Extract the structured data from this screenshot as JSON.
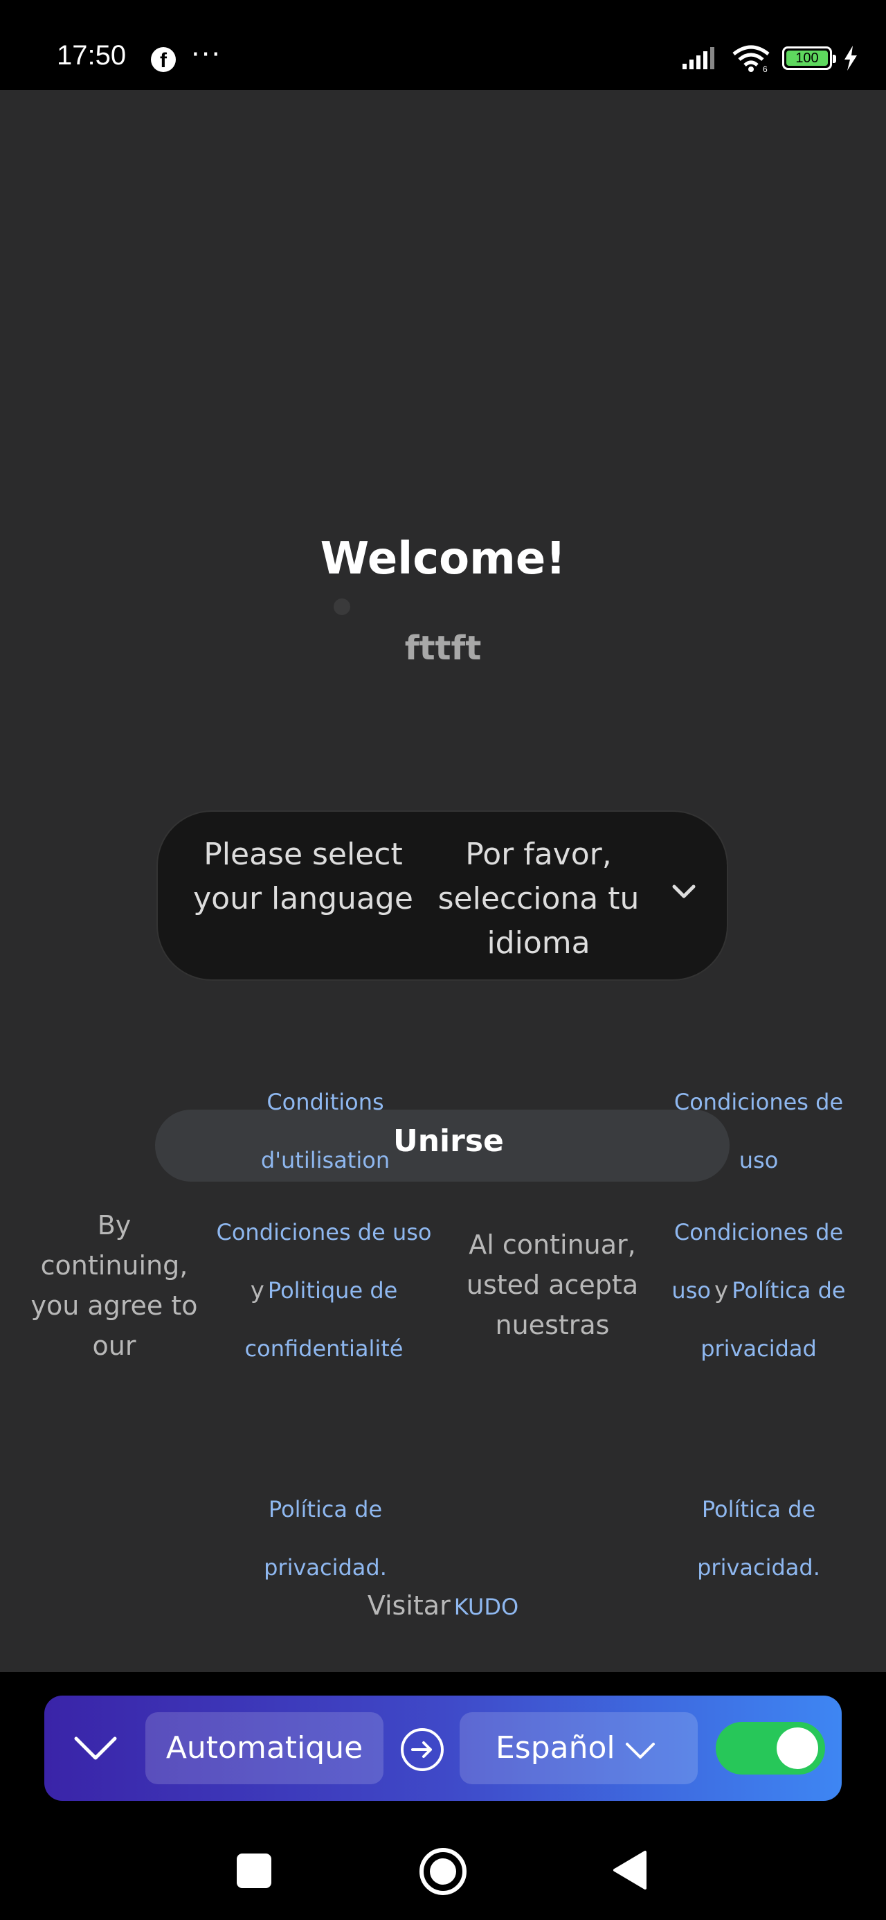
{
  "status_bar": {
    "time": "17:50",
    "fb_glyph": "f",
    "more": "···",
    "battery": "100",
    "network": "6",
    "icons": [
      "facebook-icon",
      "more-icon",
      "signal-icon",
      "wifi-icon",
      "battery-icon",
      "charging-icon"
    ]
  },
  "welcome": {
    "title": "Welcome!",
    "subtitle": "fttft"
  },
  "language_select": {
    "english": "Please select your language",
    "spanish": "Por favor, selecciona tu idioma"
  },
  "join": {
    "label": "Unirse",
    "conditions_fr_1": "Conditions",
    "conditions_fr_2": "d'utilisation",
    "conditions_es_top_1": "Condiciones de",
    "conditions_es_top_2": "uso"
  },
  "terms": {
    "agree_en": "By continuing, you agree to our",
    "conditions_es": "Condiciones de uso",
    "and_1": "y",
    "politique": "Politique de confidentialité",
    "agree_es": "Al continuar, usted acepta nuestras",
    "conditions_es_2": "Condiciones de uso",
    "and_2": "y",
    "privacy_es_2": "Política de privacidad",
    "privacy_1": "Política de privacidad.",
    "privacy_2": "Política de privacidad."
  },
  "visit": {
    "label": "Visitar",
    "link": "KUDO"
  },
  "translate_bar": {
    "source_language": "Automatique",
    "target_language": "Español",
    "toggle_on": true,
    "colors": {
      "gradient_start": "#3a24a8",
      "gradient_end": "#3e86f3",
      "toggle": "#27c759"
    }
  },
  "nav": {
    "icons": [
      "recents-icon",
      "home-icon",
      "back-icon"
    ]
  }
}
